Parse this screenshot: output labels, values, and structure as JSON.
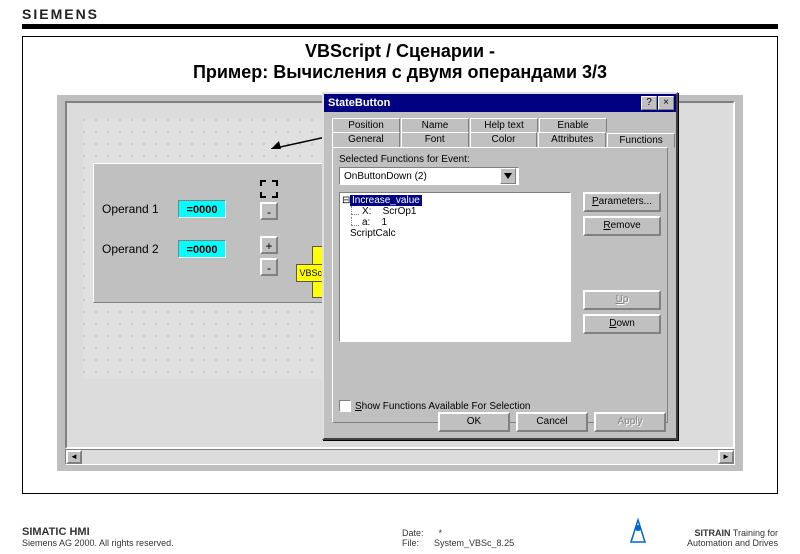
{
  "brand": "SIEMENS",
  "slide": {
    "title1": "VBScript / Сценарии -",
    "title2": "Пример: Вычисления с двумя операндами 3/3"
  },
  "ops": {
    "label1": "Operand 1",
    "value1": "=0000",
    "label2": "Operand 2",
    "value2": "=0000",
    "plus": "+",
    "minus": "-"
  },
  "vbscript_label": "VBScript",
  "dialog": {
    "title": "StateButton",
    "help_glyph": "?",
    "close_glyph": "×",
    "tabs_row1": [
      "Position",
      "Name",
      "Help text",
      "Enable"
    ],
    "tabs_row2": [
      "General",
      "Font",
      "Color",
      "Attributes",
      "Functions"
    ],
    "active_tab_index": 4,
    "field_label": "Selected Functions for Event:",
    "dropdown_value": "OnButtonDown  (2)",
    "list": {
      "selected": "Increase_value",
      "param_x_label": "X:",
      "param_x_value": "ScrOp1",
      "param_a_label": "a:",
      "param_a_value": "1",
      "item2": "ScriptCalc"
    },
    "btn_parameters": "Parameters...",
    "btn_remove": "Remove",
    "btn_up": "Up",
    "btn_down": "Down",
    "checkbox_label": "Show Functions Available For Selection",
    "ok": "OK",
    "cancel": "Cancel",
    "apply": "Apply"
  },
  "footer": {
    "product": "SIMATIC HMI",
    "copyright": "Siemens AG 2000. All rights reserved.",
    "date_label": "Date:",
    "date_value": "*",
    "file_label": "File:",
    "file_value": "System_VBSc_8.25",
    "right1": "SITRAIN Training for",
    "right2": "Automation and Drives"
  }
}
